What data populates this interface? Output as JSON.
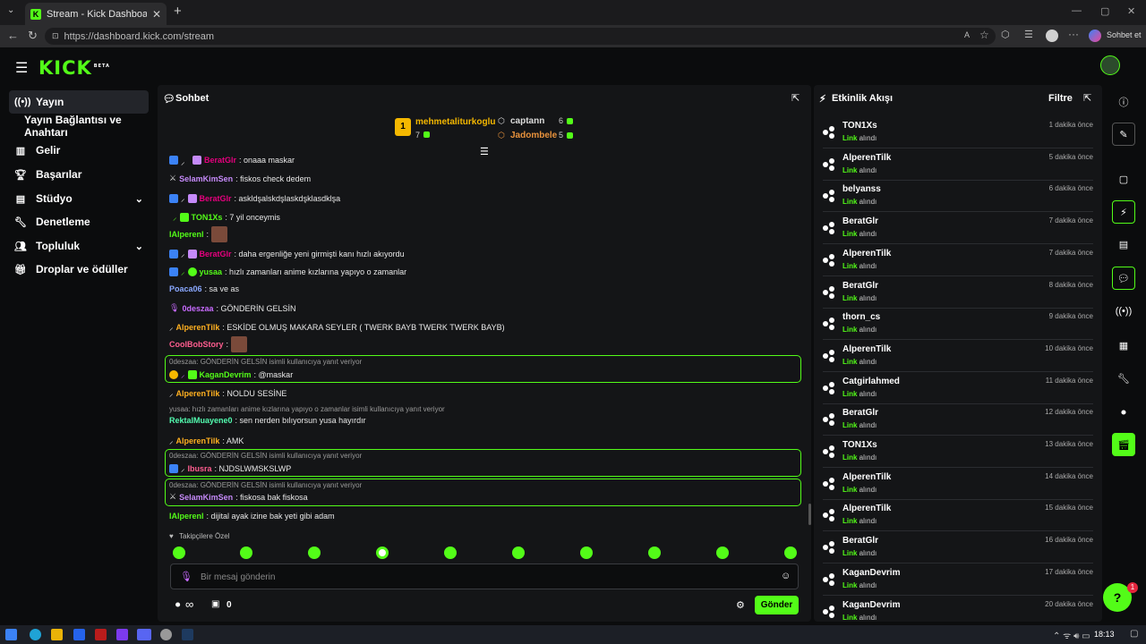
{
  "browser": {
    "tab_title": "Stream - Kick Dashboard",
    "url": "https://dashboard.kick.com/stream",
    "copilot_label": "Sohbet et"
  },
  "app": {
    "logo": "KICK",
    "logo_tag": "BETA"
  },
  "sidebar": {
    "items": [
      {
        "label": "Yayın",
        "icon": "broadcast-icon"
      },
      {
        "label": "Yayın Bağlantısı ve Anahtarı",
        "icon": ""
      },
      {
        "label": "Gelir",
        "icon": "chart-icon"
      },
      {
        "label": "Başarılar",
        "icon": "trophy-icon"
      },
      {
        "label": "Stüdyo",
        "icon": "studio-icon"
      },
      {
        "label": "Denetleme",
        "icon": "wrench-icon"
      },
      {
        "label": "Topluluk",
        "icon": "community-icon"
      },
      {
        "label": "Droplar ve ödüller",
        "icon": "gift-icon"
      }
    ]
  },
  "chat": {
    "title": "Sohbet",
    "leader1": {
      "rank": "1",
      "name": "mehmetaliturkoglu",
      "count": "7"
    },
    "leader2": {
      "name": "captann",
      "count": "6"
    },
    "leader3": {
      "name": "Jadombele",
      "count": "5"
    },
    "messages": [
      {
        "user": "BeratGlr",
        "text": ": onaaa maskar",
        "color": "#e5007e"
      },
      {
        "user": "SelamKimSen",
        "text": ": fiskos check dedem",
        "color": "#c58af9"
      },
      {
        "user": "BeratGlr",
        "text": ": askldşalskdşlaskdşklasdklşa",
        "color": "#e5007e"
      },
      {
        "user": "TON1Xs",
        "text": ": 7 yil onceymis",
        "color": "#53fc18"
      },
      {
        "user": "IAlperenl",
        "text": ":",
        "color": "#53fc18"
      },
      {
        "user": "BeratGlr",
        "text": ": daha ergenliğe yeni girmişti kanı hızlı akıyordu",
        "color": "#e5007e"
      },
      {
        "user": "yusaa",
        "text": ": hızlı zamanları anime kızlarına yapıyo o zamanlar",
        "color": "#53fc18"
      },
      {
        "user": "Poaca06",
        "text": ": sa ve as",
        "color": "#8aa8ff"
      },
      {
        "user": "0deszaa",
        "text": ": GÖNDERİN GELSİN",
        "color": "#c86bff"
      },
      {
        "user": "AlperenTilk",
        "text": ": ESKİDE OLMUŞ MAKARA SEYLER ( TWERK BAYB TWERK TWERK BAYB)",
        "color": "#ffb020"
      },
      {
        "user": "CoolBobStory",
        "text": ":",
        "color": "#ff5d8f"
      },
      {
        "user": "KaganDevrim",
        "text": ": @maskar",
        "color": "#53fc18"
      },
      {
        "user": "AlperenTilk",
        "text": ": NOLDU SESİNE",
        "color": "#ffb020"
      },
      {
        "user": "RektalMuayene0",
        "text": ": sen nerden bılıyorsun yusa hayırdır",
        "color": "#53fcb0"
      },
      {
        "user": "AlperenTilk",
        "text": ": AMK",
        "color": "#ffb020"
      },
      {
        "user": "Ibusra",
        "text": ": NJDSLWMSKSLWP",
        "color": "#ff5d8f"
      },
      {
        "user": "SelamKimSen",
        "text": ": fiskosa bak fiskosa",
        "color": "#c58af9"
      },
      {
        "user": "IAlperenl",
        "text": ": dijital ayak izine bak yeti gibi adam",
        "color": "#53fc18"
      }
    ],
    "reply_refs": [
      "0deszaa: GÖNDERİN GELSİN isimli kullanıcıya yanıt veriyor",
      "yusaa: hızlı zamanları anime kızlarına yapıyo o zamanlar isimli kullanıcıya yanıt veriyor",
      "0deszaa: GÖNDERİN GELSİN isimli kullanıcıya yanıt veriyor",
      "0deszaa: GÖNDERİN GELSİN isimli kullanıcıya yanıt veriyor"
    ],
    "followers_only": "Takipçilere Özel",
    "input_placeholder": "Bir mesaj gönderin",
    "infinity": "∞",
    "store_count": "0",
    "send_label": "Gönder"
  },
  "feed": {
    "title": "Etkinlik Akışı",
    "filter_label": "Filtre",
    "rows": [
      {
        "name": "TON1Xs",
        "ago": "1 dakika önce"
      },
      {
        "name": "AlperenTilk",
        "ago": "5 dakika önce"
      },
      {
        "name": "belyanss",
        "ago": "6 dakika önce"
      },
      {
        "name": "BeratGlr",
        "ago": "7 dakika önce"
      },
      {
        "name": "AlperenTilk",
        "ago": "7 dakika önce"
      },
      {
        "name": "BeratGlr",
        "ago": "8 dakika önce"
      },
      {
        "name": "thorn_cs",
        "ago": "9 dakika önce"
      },
      {
        "name": "AlperenTilk",
        "ago": "10 dakika önce"
      },
      {
        "name": "Catgirlahmed",
        "ago": "11 dakika önce"
      },
      {
        "name": "BeratGlr",
        "ago": "12 dakika önce"
      },
      {
        "name": "TON1Xs",
        "ago": "13 dakika önce"
      },
      {
        "name": "AlperenTilk",
        "ago": "14 dakika önce"
      },
      {
        "name": "AlperenTilk",
        "ago": "15 dakika önce"
      },
      {
        "name": "BeratGlr",
        "ago": "16 dakika önce"
      },
      {
        "name": "KaganDevrim",
        "ago": "17 dakika önce"
      },
      {
        "name": "KaganDevrim",
        "ago": "20 dakika önce"
      }
    ],
    "link_word": "Link",
    "received_word": " alındı"
  },
  "help_badge": "1",
  "taskbar": {
    "time": "18:13"
  },
  "colors": {
    "accent": "#53fc18",
    "panel": "#141517",
    "bg": "#0b0c0d"
  }
}
